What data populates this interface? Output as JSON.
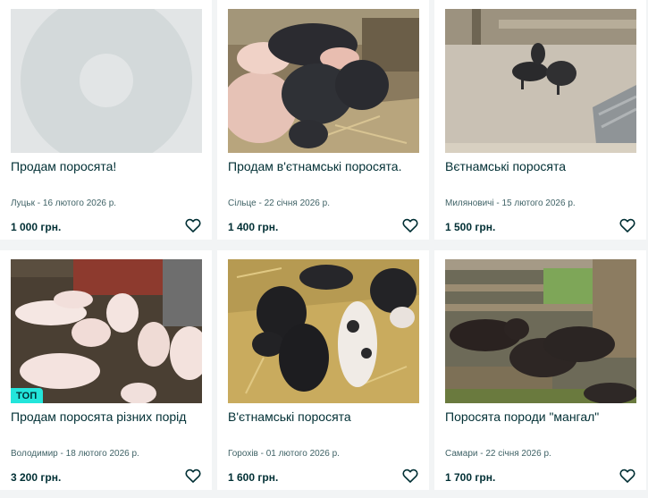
{
  "listings": [
    {
      "title": "Продам поросята!",
      "location": "Луцьк",
      "date": "16 лютого 2026 р.",
      "price": "1 000 грн.",
      "badge": "",
      "image": "placeholder-image"
    },
    {
      "title": "Продам в'єтнамські поросята.",
      "location": "Сільце",
      "date": "22 січня 2026 р.",
      "price": "1 400 грн.",
      "badge": "",
      "image": "pigs-in-pen-photo"
    },
    {
      "title": "Вєтнамські поросята",
      "location": "Миляновичі",
      "date": "15 лютого 2026 р.",
      "price": "1 500 грн.",
      "badge": "",
      "image": "black-pigs-yard-photo"
    },
    {
      "title": "Продам поросята різних порід",
      "location": "Володимир",
      "date": "18 лютого 2026 р.",
      "price": "3 200 грн.",
      "badge": "ТОП",
      "image": "white-piglets-photo"
    },
    {
      "title": "В'єтнамські поросята",
      "location": "Горохів",
      "date": "01 лютого 2026 р.",
      "price": "1 600 грн.",
      "badge": "",
      "image": "black-and-spotted-pigs-photo"
    },
    {
      "title": "Поросята породи \"мангал\"",
      "location": "Самари",
      "date": "22 січня 2026 р.",
      "price": "1 700 грн.",
      "badge": "",
      "image": "mangal-pigs-photo"
    }
  ],
  "meta_separator": " - ",
  "icons": {
    "favorite": "heart-outline-icon"
  },
  "colors": {
    "text": "#002f34",
    "muted": "#406367",
    "badge": "#23e5db",
    "background": "#f2f4f5",
    "card": "#ffffff"
  }
}
